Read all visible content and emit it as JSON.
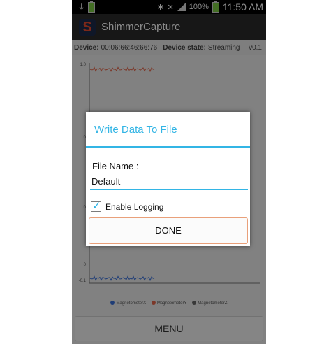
{
  "statusbar": {
    "battery": "100%",
    "time": "11:50 AM"
  },
  "app": {
    "title": "ShimmerCapture",
    "logo_letter": "S"
  },
  "device_info": {
    "device_label": "Device:",
    "device_value": "00:06:66:46:66:76",
    "state_label": "Device state:",
    "state_value": "Streaming",
    "version": "v0.1"
  },
  "plot": {
    "y_ticks": [
      "1.0",
      "0",
      "0",
      "0",
      "-0.1"
    ],
    "legend": [
      "MagnetometerX",
      "MagnetometerY",
      "MagnetometerZ"
    ],
    "colors": {
      "x": "#3a6fd8",
      "y": "#e2664b",
      "z": "#666666"
    }
  },
  "menu": {
    "label": "MENU"
  },
  "dialog": {
    "title": "Write Data To File",
    "file_label": "File Name :",
    "file_value": "Default",
    "logging_label": "Enable Logging",
    "logging_checked": true,
    "done_label": "DONE",
    "accent": "#33b5e5"
  }
}
